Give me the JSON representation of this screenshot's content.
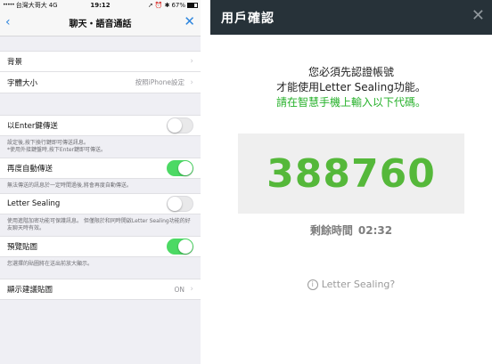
{
  "status_bar": {
    "signal": "•••••",
    "carrier": "台灣大哥大",
    "network": "4G",
    "time": "19:12",
    "battery_text": "67%",
    "battery_level": 0.67
  },
  "nav": {
    "back_glyph": "‹",
    "title": "聊天・語音通話",
    "close_glyph": "✕"
  },
  "settings": {
    "background_label": "背景",
    "font_size_label": "字體大小",
    "font_size_value": "按照iPhone設定",
    "enter_send_label": "以Enter鍵傳送",
    "enter_send_desc": "設定後,按下換行鍵即可傳送訊息。\n*使用外接鍵盤時,按下Enter鍵即可傳送。",
    "enter_send_on": false,
    "auto_resend_label": "再度自動傳送",
    "auto_resend_desc": "無法傳送的訊息於一定時間過後,將會再度自動傳送。",
    "auto_resend_on": true,
    "letter_sealing_label": "Letter Sealing",
    "letter_sealing_desc": "使用進階加密功能可保護訊息。 但僅限於和同時開啟Letter Sealing功能的好友聊天時有效。",
    "letter_sealing_on": false,
    "preview_sticker_label": "預覽貼圖",
    "preview_sticker_desc": "您選擇的貼圖將在送出前放大顯示。",
    "preview_sticker_on": true,
    "suggest_sticker_label": "顯示建議貼圖",
    "suggest_sticker_value": "ON"
  },
  "dialog": {
    "title": "用戶確認",
    "close_glyph": "✕",
    "line1": "您必須先認證帳號",
    "line2": "才能使用Letter Sealing功能。",
    "line3": "請在智慧手機上輸入以下代碼。",
    "code": "388760",
    "remaining_label": "剩餘時間",
    "remaining_time": "02:32",
    "help_icon_glyph": "i",
    "help_text": "Letter Sealing?"
  },
  "colors": {
    "toggle_on": "#4cd964",
    "ios_blue": "#2e86de",
    "dialog_header": "#273239",
    "code_green": "#55b83a",
    "instruction_green": "#26b12a"
  }
}
